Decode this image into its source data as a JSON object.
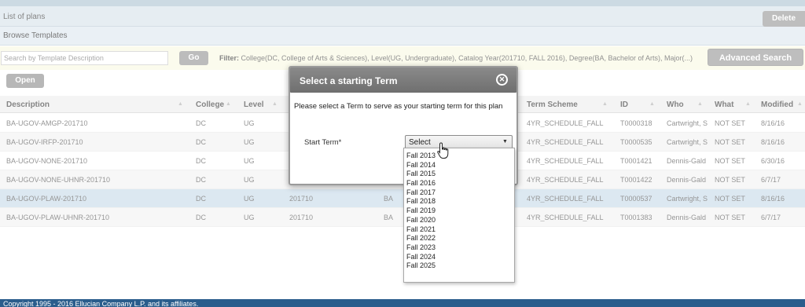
{
  "plans_bar": {
    "title": "List of plans",
    "delete_label": "Delete"
  },
  "browse": {
    "title": "Browse Templates"
  },
  "search": {
    "placeholder": "Search by Template Description",
    "go_label": "Go",
    "filter_label": "Filter:",
    "filter_value": "College(DC, College of Arts & Sciences), Level(UG, Undergraduate), Catalog Year(201710, FALL 2016), Degree(BA, Bachelor of Arts), Major(...)",
    "advanced_label": "Advanced Search"
  },
  "toolbar": {
    "open_label": "Open"
  },
  "grid": {
    "columns": [
      "Description",
      "College",
      "Level",
      "Term Scheme",
      "ID",
      "Who",
      "What",
      "Modified"
    ],
    "rows": [
      {
        "desc": "BA-UGOV-AMGP-201710",
        "college": "DC",
        "level": "UG",
        "catalog": "",
        "degree": "",
        "scheme": "4YR_SCHEDULE_FALL",
        "id": "T0000318",
        "who": "Cartwright, S",
        "what": "NOT SET",
        "modified": "8/16/16"
      },
      {
        "desc": "BA-UGOV-IRFP-201710",
        "college": "DC",
        "level": "UG",
        "catalog": "",
        "degree": "",
        "scheme": "4YR_SCHEDULE_FALL",
        "id": "T0000535",
        "who": "Cartwright, S",
        "what": "NOT SET",
        "modified": "8/16/16"
      },
      {
        "desc": "BA-UGOV-NONE-201710",
        "college": "DC",
        "level": "UG",
        "catalog": "",
        "degree": "",
        "scheme": "4YR_SCHEDULE_FALL",
        "id": "T0001421",
        "who": "Dennis-Gald",
        "what": "NOT SET",
        "modified": "6/30/16"
      },
      {
        "desc": "BA-UGOV-NONE-UHNR-201710",
        "college": "DC",
        "level": "UG",
        "catalog": "",
        "degree": "",
        "scheme": "4YR_SCHEDULE_FALL",
        "id": "T0001422",
        "who": "Dennis-Gald",
        "what": "NOT SET",
        "modified": "6/7/17"
      },
      {
        "desc": "BA-UGOV-PLAW-201710",
        "college": "DC",
        "level": "UG",
        "catalog": "201710",
        "degree": "BA",
        "scheme": "4YR_SCHEDULE_FALL",
        "id": "T0000537",
        "who": "Cartwright, S",
        "what": "NOT SET",
        "modified": "8/16/16"
      },
      {
        "desc": "BA-UGOV-PLAW-UHNR-201710",
        "college": "DC",
        "level": "UG",
        "catalog": "201710",
        "degree": "BA",
        "scheme": "4YR_SCHEDULE_FALL",
        "id": "T0001383",
        "who": "Dennis-Gald",
        "what": "NOT SET",
        "modified": "6/7/17"
      }
    ]
  },
  "modal": {
    "title": "Select a starting Term",
    "close_icon": "close-icon",
    "message": "Please select a Term to serve as your starting term for this plan",
    "term_label": "Start Term*",
    "selected": "Select",
    "options": [
      "Fall 2013",
      "Fall 2014",
      "Fall 2015",
      "Fall 2016",
      "Fall 2017",
      "Fall 2018",
      "Fall 2019",
      "Fall 2020",
      "Fall 2021",
      "Fall 2022",
      "Fall 2023",
      "Fall 2024",
      "Fall 2025"
    ]
  },
  "footer": {
    "text": "Copyright 1995 - 2016 Ellucian Company L.P. and its affiliates."
  },
  "colors": {
    "header_gray": "#7d7d7d",
    "selected_row": "#cfe0ec",
    "footer_blue": "#2a5d8c",
    "filter_bg": "#fafae6"
  }
}
